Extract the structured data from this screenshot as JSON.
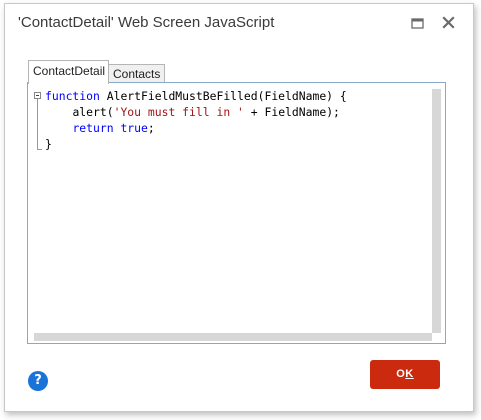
{
  "dialog": {
    "title": "'ContactDetail' Web Screen JavaScript"
  },
  "window_controls": {
    "maximize_icon": "maximize-icon",
    "close_icon": "close-icon"
  },
  "tabs": [
    {
      "label": "ContactDetail",
      "active": true
    },
    {
      "label": "Contacts",
      "active": false
    }
  ],
  "code": {
    "lines": [
      {
        "kw1": "function",
        "text": " AlertFieldMustBeFilled(FieldName) {"
      },
      {
        "indent": "    ",
        "pre": "alert(",
        "str": "'You must fill in '",
        "post": " + FieldName);"
      },
      {
        "indent": "    ",
        "kw1": "return",
        "sp": " ",
        "kw2": "true",
        "post": ";"
      },
      {
        "text": "}"
      }
    ]
  },
  "footer": {
    "help_icon": "question-icon",
    "help_glyph": "?",
    "ok_label_first": "O",
    "ok_label_rest": "K"
  },
  "colors": {
    "ok_button": "#cc2a0e",
    "help_icon": "#1a73d8",
    "keyword": "#0000ff",
    "string": "#a31515"
  }
}
